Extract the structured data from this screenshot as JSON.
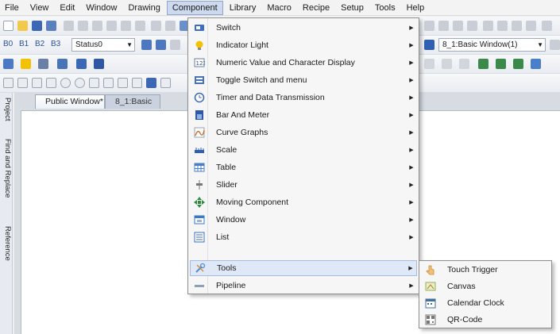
{
  "menubar": {
    "items": [
      "File",
      "View",
      "Edit",
      "Window",
      "Drawing",
      "Component",
      "Library",
      "Macro",
      "Recipe",
      "Setup",
      "Tools",
      "Help"
    ],
    "open_item": "Component"
  },
  "toolbar": {
    "bit_labels": [
      "B0",
      "B1",
      "B2",
      "B3"
    ],
    "status_combo": "Status0",
    "window_combo": "8_1:Basic Window(1)"
  },
  "sidebar": {
    "tabs": [
      "Project",
      "Find and Replace",
      "Reference"
    ]
  },
  "tabs": {
    "active": "Public Window*",
    "inactive": "8_1:Basic"
  },
  "component_menu": {
    "items": [
      {
        "label": "Switch",
        "icon": "switch-icon",
        "color": "#3a6fc4"
      },
      {
        "label": "Indicator Light",
        "icon": "lightbulb-icon",
        "color": "#f2c200"
      },
      {
        "label": "Numeric Value and Character Display",
        "icon": "numeric-display-icon",
        "color": "#6a7fa6"
      },
      {
        "label": "Toggle Switch and menu",
        "icon": "toggle-switch-icon",
        "color": "#4a74b8"
      },
      {
        "label": "Timer and Data Transmission",
        "icon": "timer-icon",
        "color": "#3b68b5"
      },
      {
        "label": "Bar And Meter",
        "icon": "bar-meter-icon",
        "color": "#2f57a6"
      },
      {
        "label": "Curve Graphs",
        "icon": "curve-graph-icon",
        "color": "#c26a2a"
      },
      {
        "label": "Scale",
        "icon": "scale-icon",
        "color": "#3060b0"
      },
      {
        "label": "Table",
        "icon": "table-icon",
        "color": "#4a7ec8"
      },
      {
        "label": "Slider",
        "icon": "slider-icon",
        "color": "#777777"
      },
      {
        "label": "Moving Component",
        "icon": "move-arrows-icon",
        "color": "#2e8b3e"
      },
      {
        "label": "Window",
        "icon": "window-icon",
        "color": "#3a78c8"
      },
      {
        "label": "List",
        "icon": "list-icon",
        "color": "#3c6fb7"
      },
      {
        "label": "Tools",
        "icon": "tools-icon",
        "color": "#5a8ad0"
      },
      {
        "label": "Pipeline",
        "icon": "pipeline-icon",
        "color": "#8aa0b8"
      }
    ],
    "highlighted": "Tools"
  },
  "tools_submenu": {
    "items": [
      {
        "label": "Touch Trigger",
        "icon": "touch-trigger-icon",
        "color": "#d08a2a"
      },
      {
        "label": "Canvas",
        "icon": "canvas-icon",
        "color": "#9ab04a"
      },
      {
        "label": "Calendar  Clock",
        "icon": "calendar-clock-icon",
        "color": "#4a6e9a"
      },
      {
        "label": "QR-Code",
        "icon": "qr-code-icon",
        "color": "#777777"
      }
    ]
  },
  "colors": {
    "menu_highlight": "#dfe8f6",
    "menubar_open": "#ccd9ee",
    "canvas": "#ffffff"
  }
}
